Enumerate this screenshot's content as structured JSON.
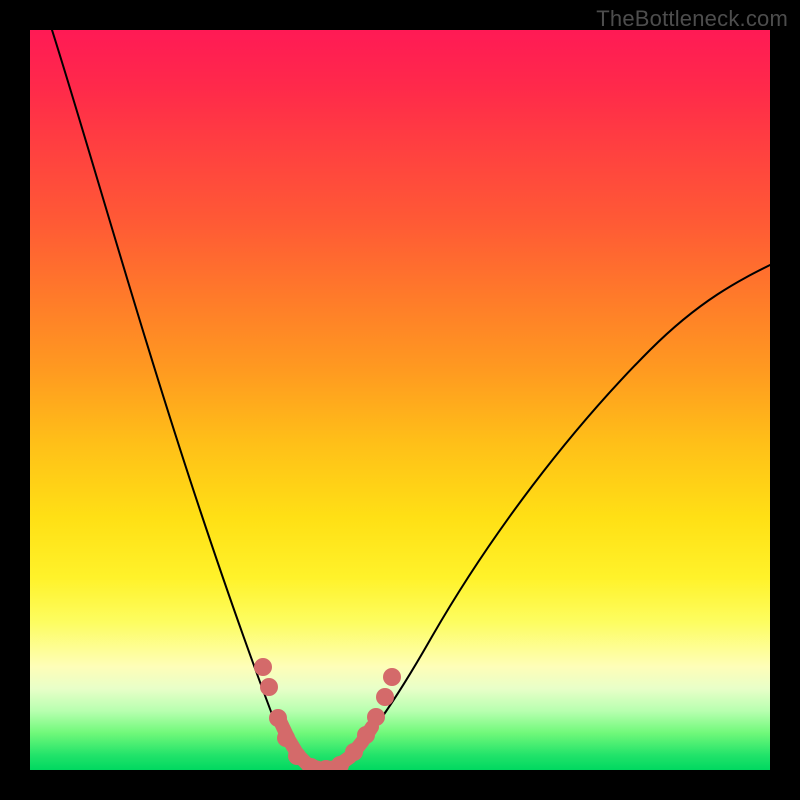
{
  "watermark": "TheBottleneck.com",
  "colors": {
    "frame": "#000000",
    "curve": "#000000",
    "marker": "#d46a6a",
    "gradient_top": "#ff1a55",
    "gradient_bottom": "#00d860"
  },
  "chart_data": {
    "type": "line",
    "title": "",
    "xlabel": "",
    "ylabel": "",
    "xlim": [
      0,
      100
    ],
    "ylim": [
      0,
      100
    ],
    "grid": false,
    "note": "No axes, ticks, or legend are rendered; values estimated from pixel positions on a 0–100 normalized scale.",
    "series": [
      {
        "name": "left-curve",
        "x": [
          3,
          6,
          10,
          14,
          18,
          22,
          26,
          29,
          32,
          34,
          36,
          37
        ],
        "y": [
          100,
          87,
          72,
          58,
          45,
          33,
          23,
          15,
          9,
          5,
          2,
          0
        ]
      },
      {
        "name": "right-curve",
        "x": [
          42,
          45,
          50,
          56,
          63,
          71,
          80,
          90,
          100
        ],
        "y": [
          0,
          5,
          12,
          21,
          31,
          41,
          51,
          60,
          68
        ]
      }
    ],
    "markers": {
      "name": "highlighted-points",
      "color": "#d46a6a",
      "points": [
        {
          "x": 31,
          "y": 14
        },
        {
          "x": 32,
          "y": 11
        },
        {
          "x": 33.5,
          "y": 6
        },
        {
          "x": 34.5,
          "y": 3
        },
        {
          "x": 36,
          "y": 1
        },
        {
          "x": 38,
          "y": 0
        },
        {
          "x": 40,
          "y": 0
        },
        {
          "x": 42,
          "y": 1
        },
        {
          "x": 44,
          "y": 4
        },
        {
          "x": 45.5,
          "y": 7
        },
        {
          "x": 47,
          "y": 10
        },
        {
          "x": 48,
          "y": 13
        }
      ]
    }
  }
}
